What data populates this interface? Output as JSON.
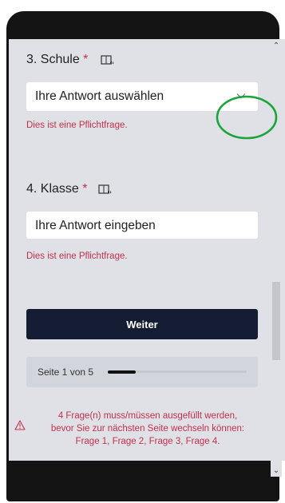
{
  "questions": [
    {
      "number_title": "3. Schule",
      "required_mark": "*",
      "placeholder": "Ihre Antwort auswählen",
      "error": "Dies ist eine Pflichtfrage."
    },
    {
      "number_title": "4. Klasse",
      "required_mark": "*",
      "placeholder": "Ihre Antwort eingeben",
      "error": "Dies ist eine Pflichtfrage."
    }
  ],
  "next_button": "Weiter",
  "progress": {
    "label": "Seite 1 von 5",
    "fraction": 0.2
  },
  "warning": {
    "line1": "4 Frage(n) muss/müssen ausgefüllt werden,",
    "line2": "bevor Sie zur nächsten Seite wechseln können:",
    "line3": "Frage 1, Frage 2, Frage 3, Frage 4."
  },
  "colors": {
    "accent": "#141d34",
    "error": "#c4314b",
    "annotation_circle": "#1aa53a"
  },
  "icons": {
    "speaker": "immersive-reader-icon",
    "dropdown": "chevron-down-icon",
    "warning": "warning-triangle-icon"
  }
}
